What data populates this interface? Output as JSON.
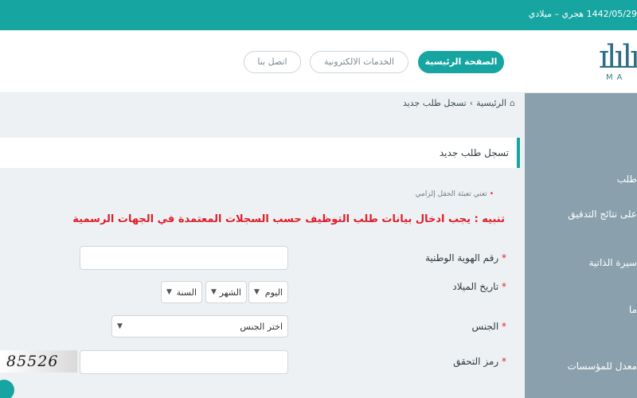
{
  "topbar": {
    "date_text": "1442/05/29 هجري – ميلادي"
  },
  "header": {
    "logo_mark": "ɪlılı",
    "logo_sub": "MA",
    "nav": {
      "home": "الصفحة الرئيسية",
      "services": "الخدمات الالكترونية",
      "contact": "اتصل بنا"
    }
  },
  "sidebar": {
    "items": [
      "طلب",
      "على نتائج التدقيق",
      "سيرة الذاتية",
      "ما",
      "معدل للمؤسسات"
    ]
  },
  "breadcrumb": {
    "home": "الرئيسية",
    "separator": "›",
    "current": "تسجل طلب جديد"
  },
  "page": {
    "title": "تسجل طلب جديد",
    "required_note": "تعني تعبئة الحقل إلزامي",
    "required_star": "•",
    "warning": "تنبيه : يجب ادخال بيانات طلب التوظيف حسب السجلات المعتمدة في الجهات الرسمية"
  },
  "form": {
    "required_mark": "*",
    "national_id": {
      "label": "رقم الهوية الوطنية",
      "value": ""
    },
    "birth_date": {
      "label": "تاريخ الميلاد",
      "day": "اليوم",
      "month": "الشهر",
      "year": "السنة"
    },
    "gender": {
      "label": "الجنس",
      "selected": "اختر الجنس"
    },
    "captcha": {
      "label": "رمز التحقق",
      "value": "",
      "code": "85526"
    }
  },
  "icons": {
    "home": "home-icon",
    "chevron": "chevron-down-icon"
  },
  "colors": {
    "accent": "#16a5a1",
    "sidebar": "#8aa1ad",
    "warning": "#e01e2b",
    "main_bg": "#eef1f3"
  }
}
